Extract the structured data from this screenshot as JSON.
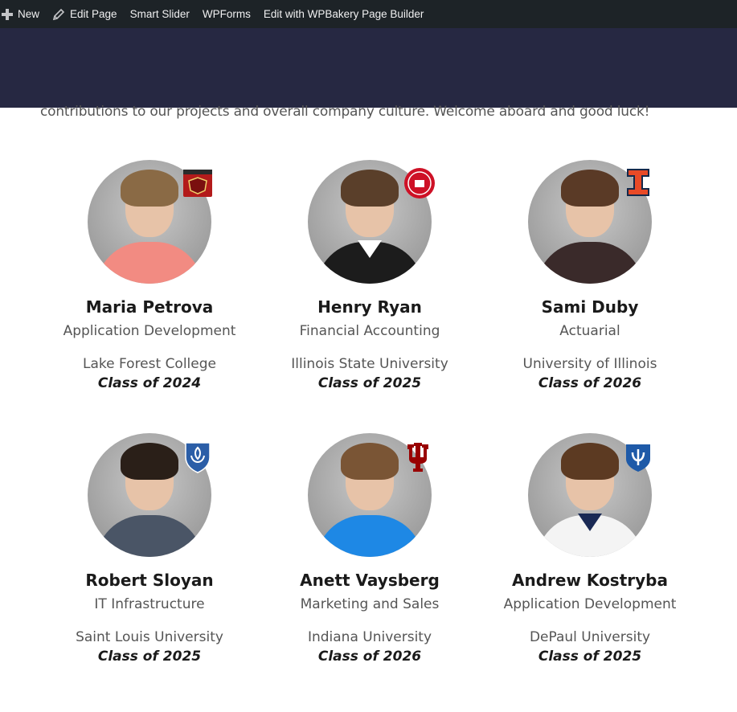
{
  "admin_bar": {
    "new_label": "New",
    "edit_page_label": "Edit Page",
    "smart_slider_label": "Smart Slider",
    "wpforms_label": "WPForms",
    "wpbakery_label": "Edit with WPBakery Page Builder"
  },
  "intro": {
    "text": "contributions to our projects and overall company culture. Welcome aboard and good luck!"
  },
  "team": [
    {
      "name": "Maria Petrova",
      "department": "Application Development",
      "school": "Lake Forest College",
      "class": "Class of 2024",
      "badge": "lake-forest-shield-icon",
      "hair_color": "#8a6a45",
      "shirt_color": "#f28b82"
    },
    {
      "name": "Henry Ryan",
      "department": "Financial Accounting",
      "school": "Illinois State University",
      "class": "Class of 2025",
      "badge": "illinois-state-seal-icon",
      "hair_color": "#5a3f2a",
      "shirt_color": "#1c1c1c"
    },
    {
      "name": "Sami Duby",
      "department": "Actuarial",
      "school": "University of Illinois",
      "class": "Class of 2026",
      "badge": "illinois-block-i-icon",
      "hair_color": "#5a3a26",
      "shirt_color": "#3a2a2a"
    },
    {
      "name": "Robert Sloyan",
      "department": "IT Infrastructure",
      "school": "Saint Louis University",
      "class": "Class of 2025",
      "badge": "saint-louis-fleur-shield-icon",
      "hair_color": "#2a1f18",
      "shirt_color": "#4a5566"
    },
    {
      "name": "Anett Vaysberg",
      "department": "Marketing and Sales",
      "school": "Indiana University",
      "class": "Class of 2026",
      "badge": "indiana-trident-icon",
      "hair_color": "#7a5535",
      "shirt_color": "#1e88e5"
    },
    {
      "name": "Andrew Kostryba",
      "department": "Application Development",
      "school": "DePaul University",
      "class": "Class of 2025",
      "badge": "depaul-shield-icon",
      "hair_color": "#5c3a22",
      "shirt_color": "#f4f4f4"
    }
  ],
  "colors": {
    "admin_bar_bg": "#1d2327",
    "header_band_bg": "#262842",
    "lake_forest_red": "#b31b1b",
    "illinois_state_red": "#ce1126",
    "illinois_orange": "#e84a27",
    "saint_louis_blue": "#2b5ea7",
    "indiana_crimson": "#990000",
    "depaul_blue": "#1e5aa8"
  }
}
